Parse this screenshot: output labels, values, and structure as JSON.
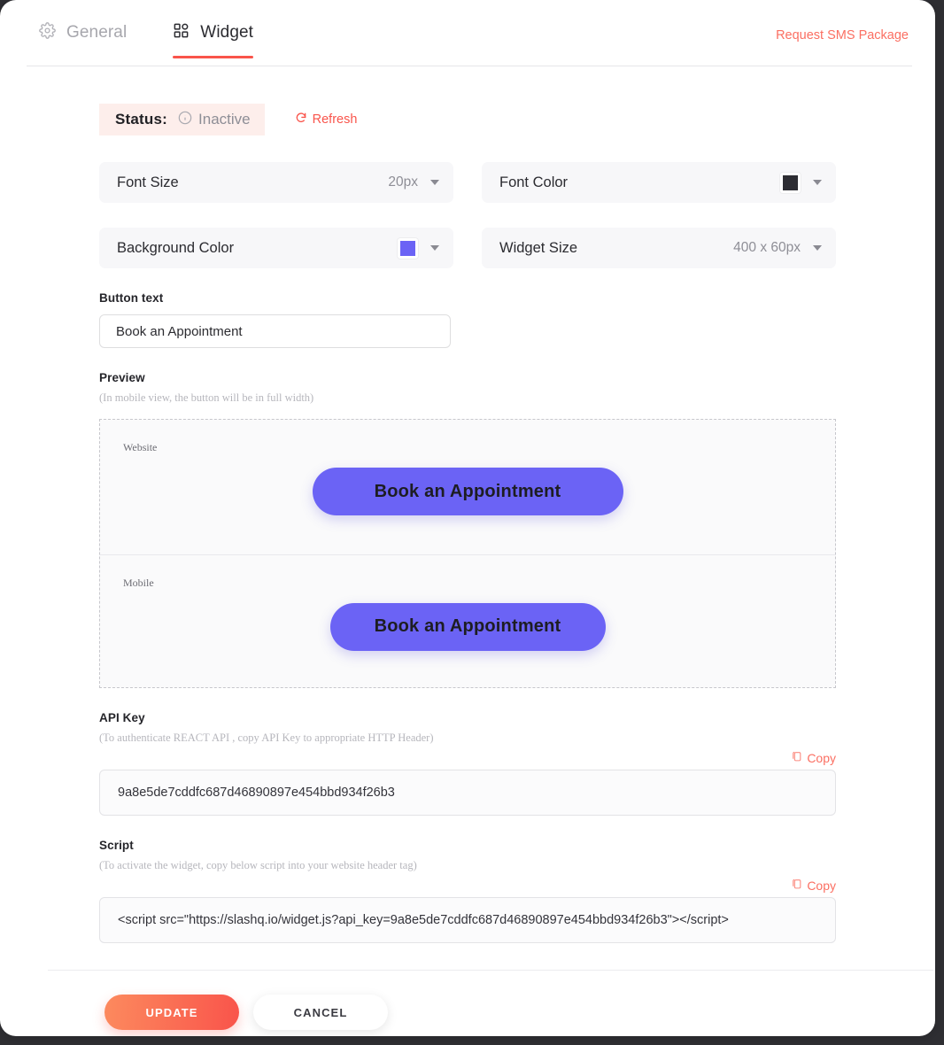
{
  "header": {
    "tabs": [
      {
        "label": "General",
        "icon": "gear-icon",
        "active": false
      },
      {
        "label": "Widget",
        "icon": "grid-icon",
        "active": true
      }
    ],
    "request_link": "Request SMS Package"
  },
  "status": {
    "label": "Status:",
    "value": "Inactive",
    "refresh_label": "Refresh",
    "pill_bg": "#fdeeeb",
    "accent": "#f9544b"
  },
  "settings": [
    {
      "label": "Font Size",
      "value": "20px",
      "type": "text"
    },
    {
      "label": "Font Color",
      "value": "",
      "type": "color",
      "color": "#2d2d33"
    },
    {
      "label": "Background Color",
      "value": "",
      "type": "color",
      "color": "#6b63f5"
    },
    {
      "label": "Widget Size",
      "value": "400 x 60px",
      "type": "text"
    }
  ],
  "button_text": {
    "label": "Button text",
    "value": "Book an Appointment"
  },
  "preview": {
    "label": "Preview",
    "hint": "(In mobile view, the button will be in full width)",
    "sections": [
      {
        "tag": "Website",
        "button_label": "Book an Appointment"
      },
      {
        "tag": "Mobile",
        "button_label": "Book an Appointment"
      }
    ],
    "button_bg": "#6b63f5",
    "button_color": "#1d1d22"
  },
  "api_key": {
    "label": "API Key",
    "hint": "(To authenticate REACT API , copy API Key to appropriate HTTP Header)",
    "copy_label": "Copy",
    "value": "9a8e5de7cddfc687d46890897e454bbd934f26b3"
  },
  "script": {
    "label": "Script",
    "hint": "(To activate the widget, copy below script into your website header tag)",
    "copy_label": "Copy",
    "value": "<script src=\"https://slashq.io/widget.js?api_key=9a8e5de7cddfc687d46890897e454bbd934f26b3\"></script>"
  },
  "footer": {
    "update_label": "UPDATE",
    "cancel_label": "CANCEL"
  }
}
